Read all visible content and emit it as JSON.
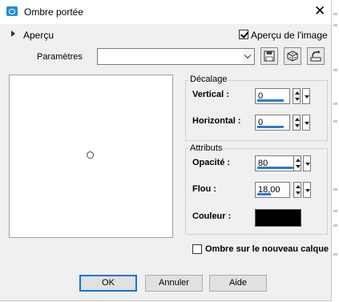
{
  "window": {
    "title": "Ombre portée",
    "close_glyph": "✕"
  },
  "preview_section": {
    "label": "Aperçu",
    "checkbox_label": "Aperçu de l'image",
    "checked": true
  },
  "presets": {
    "label": "Paramètres",
    "value": ""
  },
  "offset_group": {
    "title": "Décalage",
    "vertical_label": "Vertical :",
    "vertical_value": "0",
    "horizontal_label": "Horizontal :",
    "horizontal_value": "0"
  },
  "attributes_group": {
    "title": "Attributs",
    "opacity_label": "Opacité :",
    "opacity_value": "80",
    "blur_label": "Flou :",
    "blur_value": "18,00",
    "color_label": "Couleur :",
    "color_value": "#000000"
  },
  "new_layer": {
    "label": "Ombre sur le nouveau calque",
    "checked": false
  },
  "buttons": {
    "ok": "OK",
    "cancel": "Annuler",
    "help": "Aide"
  },
  "accent_color": "#2a7ad5",
  "icons": [
    "app-icon",
    "chevron-right-icon",
    "save-preset-icon",
    "random-dice-icon",
    "reset-icon"
  ]
}
